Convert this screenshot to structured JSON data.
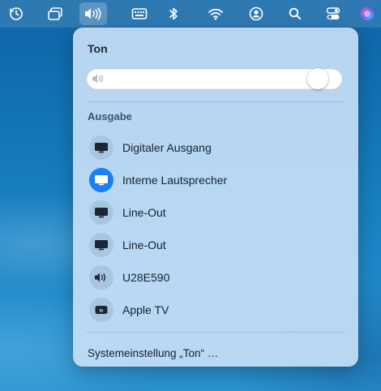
{
  "menubar": {
    "items": [
      {
        "icon": "time-machine-icon"
      },
      {
        "icon": "window-switcher-icon"
      },
      {
        "icon": "volume-icon",
        "active": true
      },
      {
        "icon": "keyboard-icon"
      },
      {
        "icon": "bluetooth-icon"
      },
      {
        "icon": "wifi-icon"
      },
      {
        "icon": "user-icon"
      },
      {
        "icon": "search-icon"
      },
      {
        "icon": "control-center-icon"
      },
      {
        "icon": "siri-icon"
      }
    ]
  },
  "sound_panel": {
    "title": "Ton",
    "volume": {
      "level": 0.94,
      "icon": "speaker-icon"
    },
    "output_section_title": "Ausgabe",
    "devices": [
      {
        "label": "Digitaler Ausgang",
        "icon": "display-icon",
        "selected": false
      },
      {
        "label": "Interne Lautsprecher",
        "icon": "display-icon",
        "selected": true
      },
      {
        "label": "Line-Out",
        "icon": "display-icon",
        "selected": false
      },
      {
        "label": "Line-Out",
        "icon": "display-icon",
        "selected": false
      },
      {
        "label": "U28E590",
        "icon": "speaker-icon",
        "selected": false
      },
      {
        "label": "Apple TV",
        "icon": "apple-tv-icon",
        "selected": false
      }
    ],
    "settings_link": "Systemeinstellung „Ton“ …"
  },
  "colors": {
    "accent": "#1a7ef5",
    "panel_background": "#c4def6",
    "menubar_background": "#2f79b3"
  }
}
